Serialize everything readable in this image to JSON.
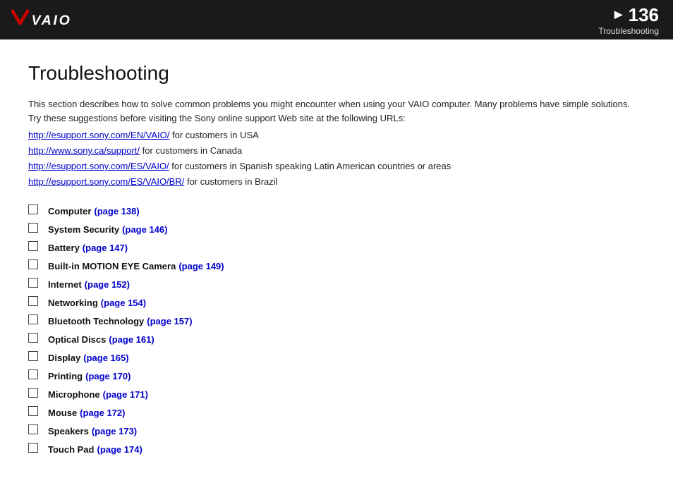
{
  "header": {
    "page_number": "136",
    "arrow": "▶",
    "section_title": "Troubleshooting",
    "logo_alt": "VAIO"
  },
  "page": {
    "title": "Troubleshooting",
    "intro": "This section describes how to solve common problems you might encounter when using your VAIO computer. Many problems have simple solutions. Try these suggestions before visiting the Sony online support Web site at the following URLs:",
    "links": [
      {
        "url": "http://esupport.sony.com/EN/VAIO/",
        "suffix": " for customers in USA"
      },
      {
        "url": "http://www.sony.ca/support/",
        "suffix": " for customers in Canada"
      },
      {
        "url": "http://esupport.sony.com/ES/VAIO/",
        "suffix": " for customers in Spanish speaking Latin American countries or areas"
      },
      {
        "url": "http://esupport.sony.com/ES/VAIO/BR/",
        "suffix": " for customers in Brazil"
      }
    ],
    "toc": [
      {
        "label": "Computer",
        "page_text": "(page 138)"
      },
      {
        "label": "System Security",
        "page_text": "(page 146)"
      },
      {
        "label": "Battery",
        "page_text": "(page 147)"
      },
      {
        "label": "Built-in MOTION EYE Camera",
        "page_text": "(page 149)"
      },
      {
        "label": "Internet",
        "page_text": "(page 152)"
      },
      {
        "label": "Networking",
        "page_text": "(page 154)"
      },
      {
        "label": "Bluetooth Technology",
        "page_text": "(page 157)"
      },
      {
        "label": "Optical Discs",
        "page_text": "(page 161)"
      },
      {
        "label": "Display",
        "page_text": "(page 165)"
      },
      {
        "label": "Printing",
        "page_text": "(page 170)"
      },
      {
        "label": "Microphone",
        "page_text": "(page 171)"
      },
      {
        "label": "Mouse",
        "page_text": "(page 172)"
      },
      {
        "label": "Speakers",
        "page_text": "(page 173)"
      },
      {
        "label": "Touch Pad",
        "page_text": "(page 174)"
      }
    ]
  }
}
